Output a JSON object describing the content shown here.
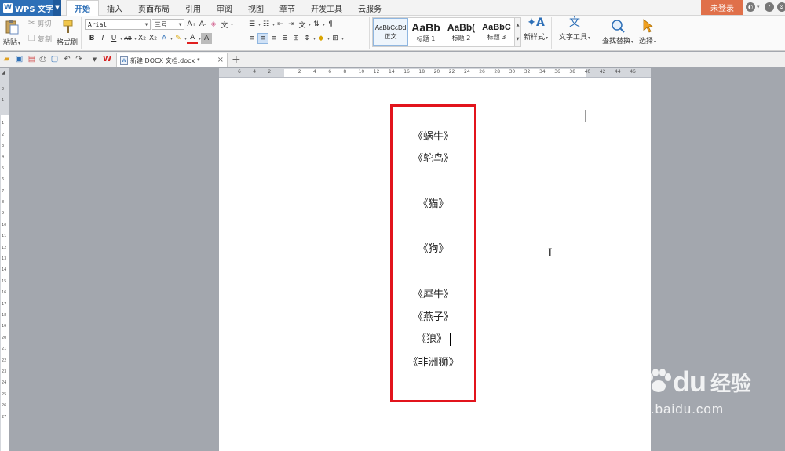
{
  "app": {
    "name": "WPS 文字",
    "logo_letter": "W"
  },
  "menu": {
    "items": [
      "开始",
      "插入",
      "页面布局",
      "引用",
      "审阅",
      "视图",
      "章节",
      "开发工具",
      "云服务"
    ],
    "active": "开始",
    "login_label": "未登录"
  },
  "ribbon": {
    "paste_label": "粘贴",
    "cut_label": "剪切",
    "copy_label": "复制",
    "format_painter_label": "格式刷",
    "font_name": "Arial",
    "font_size": "三号",
    "styles": [
      {
        "sample": "AaBbCcDd",
        "name": "正文"
      },
      {
        "sample": "AaBb",
        "name": "标题 1"
      },
      {
        "sample": "AaBb(",
        "name": "标题 2"
      },
      {
        "sample": "AaBbC",
        "name": "标题 3"
      }
    ],
    "new_style_label": "新样式",
    "text_tools_label": "文字工具",
    "find_replace_label": "查找替换",
    "select_label": "选择"
  },
  "tabs": {
    "doc_title": "新建 DOCX 文档.docx *"
  },
  "ruler": {
    "h_numbers": [
      "6",
      "4",
      "2",
      "",
      "2",
      "4",
      "6",
      "8",
      "10",
      "12",
      "14",
      "16",
      "18",
      "20",
      "22",
      "24",
      "26",
      "28",
      "30",
      "32",
      "34",
      "36",
      "38",
      "40",
      "42",
      "44",
      "46"
    ],
    "v_numbers": [
      "2",
      "1",
      "",
      "1",
      "2",
      "3",
      "4",
      "5",
      "6",
      "7",
      "8",
      "9",
      "10",
      "11",
      "12",
      "13",
      "14",
      "15",
      "16",
      "17",
      "18",
      "19",
      "20",
      "21",
      "22",
      "23",
      "24",
      "25",
      "26",
      "27"
    ]
  },
  "document": {
    "lines": [
      "《蜗牛》",
      "《鸵鸟》",
      "",
      "《猫》",
      "",
      "《狗》",
      "",
      "《犀牛》",
      "《燕子》",
      "《狼》",
      "《非洲狮》"
    ]
  },
  "watermark": {
    "bai": "Bai",
    "du": "du",
    "cn": "经验",
    "url": "jingyan.baidu.com"
  },
  "colors": {
    "accent": "#2d6fb7",
    "login_bg": "#e0704a",
    "highlight_border": "#e2141c"
  }
}
